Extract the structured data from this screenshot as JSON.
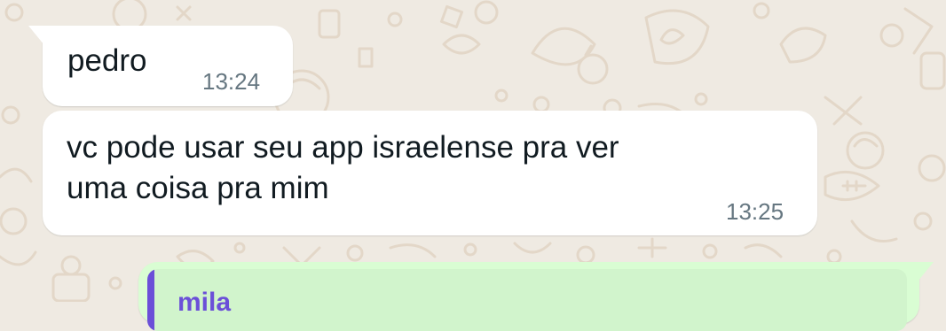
{
  "theme": {
    "wallpaper_color": "#efeae2",
    "doodle_color": "#e3d7c8",
    "incoming_bubble_color": "#ffffff",
    "outgoing_bubble_color": "#d9fdd3",
    "quote_accent_color": "#6b4fd8"
  },
  "messages": [
    {
      "direction": "incoming",
      "text": "pedro",
      "time": "13:24"
    },
    {
      "direction": "incoming",
      "text": "vc pode usar seu app israelense pra ver\numa coisa pra mim",
      "time": "13:25"
    },
    {
      "direction": "outgoing",
      "quoted_author": "mila"
    }
  ]
}
